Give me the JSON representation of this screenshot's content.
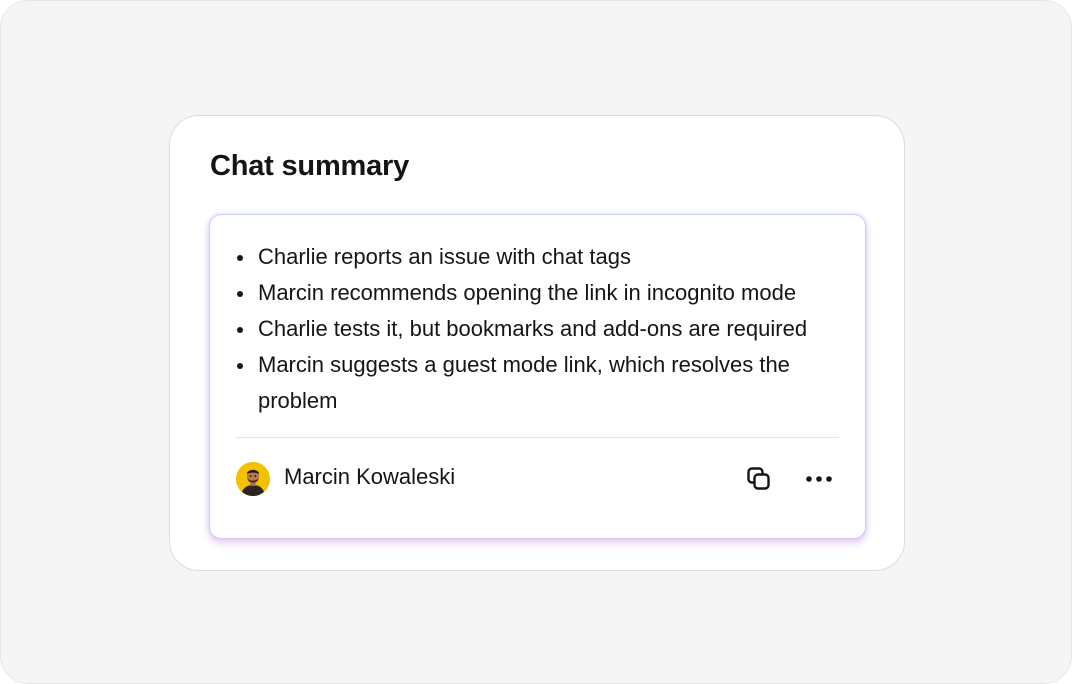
{
  "card": {
    "title": "Chat summary"
  },
  "summary": {
    "bullets": [
      "Charlie reports an issue with chat tags",
      "Marcin recommends opening the link in incognito mode",
      "Charlie tests it, but bookmarks and add-ons are required",
      "Marcin suggests a guest mode link, which resolves the problem"
    ]
  },
  "footer": {
    "author_name": "Marcin Kowaleski",
    "avatar_icon": "person-avatar",
    "actions": [
      {
        "icon": "copy-icon"
      },
      {
        "icon": "more-horizontal-icon"
      }
    ]
  },
  "colors": {
    "background": "#f5f5f5",
    "card": "#ffffff",
    "text": "#151515",
    "avatar_bg": "#f2c200",
    "glow_blue": "#c8d0f5",
    "glow_purple": "#dcc4ee"
  }
}
